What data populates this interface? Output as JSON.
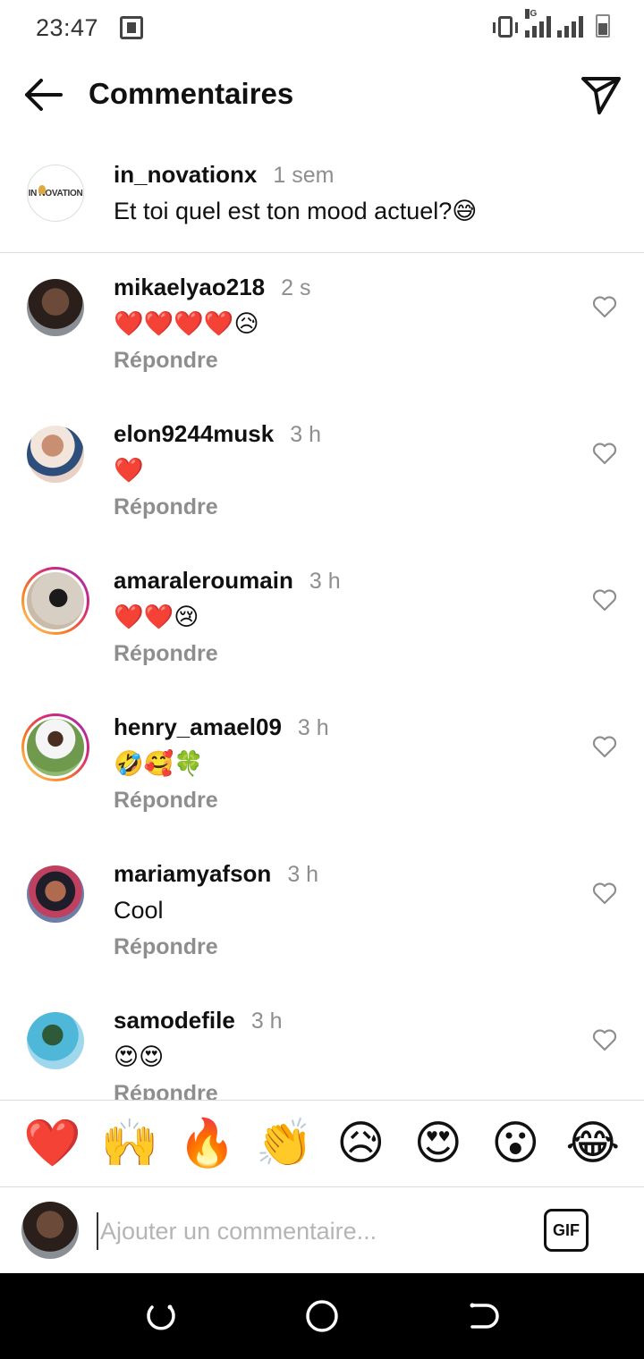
{
  "status_bar": {
    "time": "23:47",
    "network": "3G",
    "icons": [
      "screenshot-icon",
      "vibrate-icon",
      "signal-icon",
      "battery-icon"
    ]
  },
  "header": {
    "title": "Commentaires",
    "back_icon": "arrow-left-icon",
    "share_icon": "send-icon"
  },
  "caption": {
    "username": "in_novationx",
    "time": "1 sem",
    "text": "Et toi quel est ton mood actuel?😅",
    "avatar_logo": "IN NOVATION"
  },
  "comments": [
    {
      "username": "mikaelyao218",
      "time": "2 s",
      "text": "❤️❤️❤️❤️😥",
      "reply": "Répondre",
      "story_ring": false
    },
    {
      "username": "elon9244musk",
      "time": "3 h",
      "text": "❤️",
      "reply": "Répondre",
      "story_ring": false
    },
    {
      "username": "amaraleroumain",
      "time": "3 h",
      "text": "❤️❤️😢",
      "reply": "Répondre",
      "story_ring": true
    },
    {
      "username": "henry_amael09",
      "time": "3 h",
      "text": "🤣🥰🍀",
      "reply": "Répondre",
      "story_ring": true
    },
    {
      "username": "mariamyafson",
      "time": "3 h",
      "text": "Cool",
      "reply": "Répondre",
      "story_ring": false
    },
    {
      "username": "samodefile",
      "time": "3 h",
      "text": "😍😍",
      "reply": "Répondre",
      "story_ring": false
    }
  ],
  "reactions": [
    "❤️",
    "🙌",
    "🔥",
    "👏",
    "😥",
    "😍",
    "😮",
    "😂"
  ],
  "composer": {
    "placeholder": "Ajouter un commentaire...",
    "gif_label": "GIF"
  },
  "colors": {
    "muted": "#8e8e8e",
    "divider": "#dbdbdb",
    "story_ring": "#d62976"
  }
}
